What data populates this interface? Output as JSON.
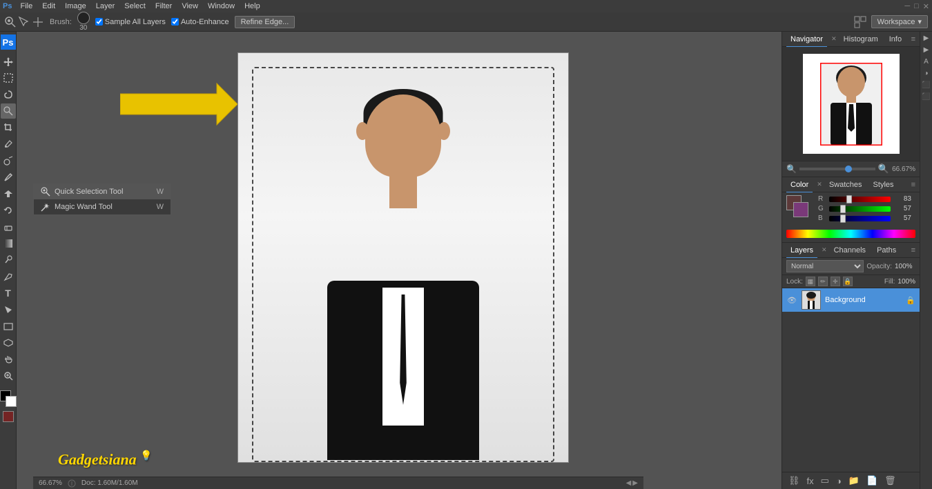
{
  "app": {
    "title": "Adobe Photoshop"
  },
  "menu": {
    "items": [
      "File",
      "Edit",
      "Image",
      "Layer",
      "Select",
      "Filter",
      "View",
      "Window",
      "Help"
    ]
  },
  "options_bar": {
    "brush_label": "Brush:",
    "brush_size": "30",
    "sample_all_layers": "Sample All Layers",
    "auto_enhance": "Auto-Enhance",
    "refine_edge": "Refine Edge...",
    "workspace": "Workspace"
  },
  "tools": {
    "selection_tool_label": "Quick Selection Tool",
    "selection_shortcut": "W",
    "magic_wand_label": "Magic Wand Tool",
    "magic_wand_shortcut": "W"
  },
  "navigator": {
    "tab_label": "Navigator",
    "histogram_label": "Histogram",
    "info_label": "Info",
    "zoom_level": "66.67%"
  },
  "color_panel": {
    "tab_label": "Color",
    "swatches_label": "Swatches",
    "styles_label": "Styles",
    "r_label": "R",
    "g_label": "G",
    "b_label": "B",
    "r_value": "83",
    "g_value": "57",
    "b_value": "57"
  },
  "layers_panel": {
    "tab_label": "Layers",
    "channels_label": "Channels",
    "paths_label": "Paths",
    "blend_mode": "Normal",
    "opacity_label": "Opacity:",
    "opacity_value": "100%",
    "lock_label": "Lock:",
    "fill_label": "Fill:",
    "fill_value": "100%",
    "layer_name": "Background"
  },
  "status": {
    "zoom": "66.67%",
    "doc_size": "Doc: 1.60M/1.60M"
  },
  "watermark": {
    "text": "Gadgetsiana"
  },
  "arrow": {
    "label": "arrow-pointing-tool"
  }
}
